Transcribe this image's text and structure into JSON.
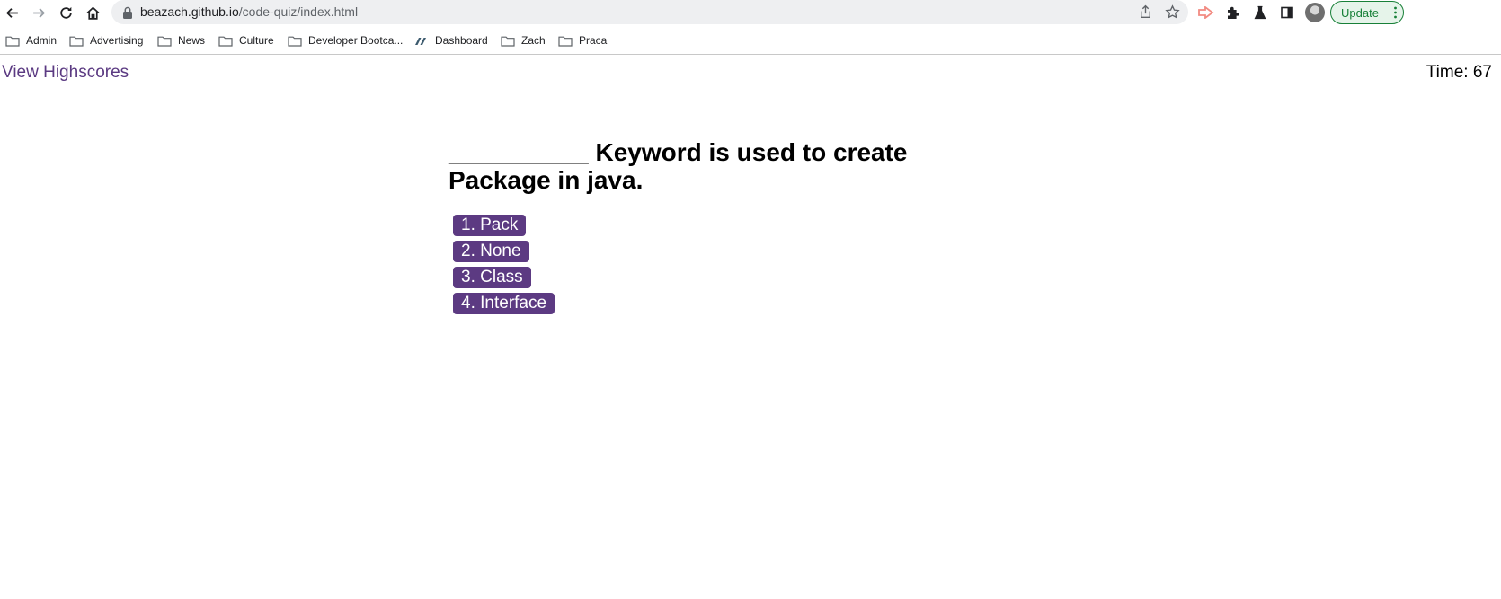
{
  "browser": {
    "url_host": "beazach.github.io",
    "url_path": "/code-quiz/index.html",
    "update_label": "Update"
  },
  "bookmarks": [
    {
      "label": "Admin",
      "icon": "folder-icon"
    },
    {
      "label": "Advertising",
      "icon": "folder-icon"
    },
    {
      "label": "News",
      "icon": "folder-icon"
    },
    {
      "label": "Culture",
      "icon": "folder-icon"
    },
    {
      "label": "Developer Bootca...",
      "icon": "folder-icon"
    },
    {
      "label": "Dashboard",
      "icon": "dashboard-favicon-icon"
    },
    {
      "label": "Zach",
      "icon": "folder-icon"
    },
    {
      "label": "Praca",
      "icon": "folder-icon"
    }
  ],
  "header": {
    "highscores_label": "View Highscores",
    "timer_label": "Time:",
    "timer_value": "67"
  },
  "quiz": {
    "question": "__________ Keyword is used to create Package in java.",
    "answers": [
      "1. Pack",
      "2. None",
      "3. Class",
      "4. Interface"
    ]
  },
  "colors": {
    "accent": "#5c3a82",
    "update_green": "#188038"
  }
}
